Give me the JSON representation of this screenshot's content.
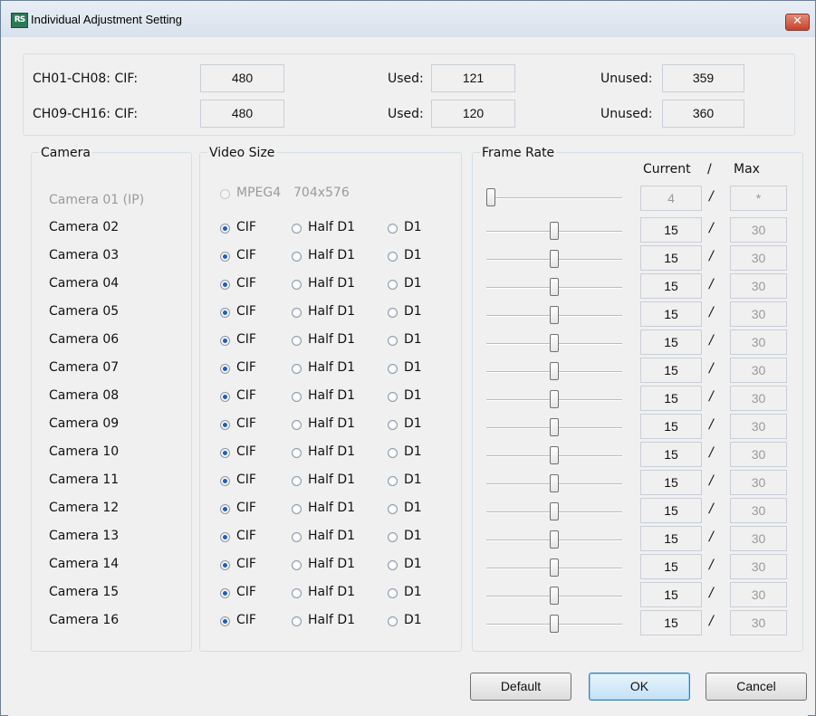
{
  "window": {
    "title": "Individual Adjustment Setting",
    "app_icon_text": "RS",
    "close_glyph": "✕"
  },
  "summary": [
    {
      "label": "CH01-CH08: CIF:",
      "total": "480",
      "used_label": "Used:",
      "used": "121",
      "unused_label": "Unused:",
      "unused": "359"
    },
    {
      "label": "CH09-CH16: CIF:",
      "total": "480",
      "used_label": "Used:",
      "used": "120",
      "unused_label": "Unused:",
      "unused": "360"
    }
  ],
  "groups": {
    "camera": "Camera",
    "video_size": "Video Size",
    "frame_rate": "Frame Rate"
  },
  "frame_rate_headers": {
    "current": "Current",
    "sep": "/",
    "max": "Max"
  },
  "slash": "/",
  "video_options": {
    "cif": "CIF",
    "half_d1": "Half D1",
    "d1": "D1"
  },
  "ip_camera": {
    "name": "Camera 01 (IP)",
    "format": "MPEG4",
    "resolution": "704x576",
    "current": "4",
    "max": "*",
    "slider_value": 4,
    "disabled": true
  },
  "cameras": [
    {
      "name": "Camera 02",
      "selected": "CIF",
      "current": "15",
      "max": "30",
      "slider_value": 15
    },
    {
      "name": "Camera 03",
      "selected": "CIF",
      "current": "15",
      "max": "30",
      "slider_value": 15
    },
    {
      "name": "Camera 04",
      "selected": "CIF",
      "current": "15",
      "max": "30",
      "slider_value": 15
    },
    {
      "name": "Camera 05",
      "selected": "CIF",
      "current": "15",
      "max": "30",
      "slider_value": 15
    },
    {
      "name": "Camera 06",
      "selected": "CIF",
      "current": "15",
      "max": "30",
      "slider_value": 15
    },
    {
      "name": "Camera 07",
      "selected": "CIF",
      "current": "15",
      "max": "30",
      "slider_value": 15
    },
    {
      "name": "Camera 08",
      "selected": "CIF",
      "current": "15",
      "max": "30",
      "slider_value": 15
    },
    {
      "name": "Camera 09",
      "selected": "CIF",
      "current": "15",
      "max": "30",
      "slider_value": 15
    },
    {
      "name": "Camera 10",
      "selected": "CIF",
      "current": "15",
      "max": "30",
      "slider_value": 15
    },
    {
      "name": "Camera 11",
      "selected": "CIF",
      "current": "15",
      "max": "30",
      "slider_value": 15
    },
    {
      "name": "Camera 12",
      "selected": "CIF",
      "current": "15",
      "max": "30",
      "slider_value": 15
    },
    {
      "name": "Camera 13",
      "selected": "CIF",
      "current": "15",
      "max": "30",
      "slider_value": 15
    },
    {
      "name": "Camera 14",
      "selected": "CIF",
      "current": "15",
      "max": "30",
      "slider_value": 15
    },
    {
      "name": "Camera 15",
      "selected": "CIF",
      "current": "15",
      "max": "30",
      "slider_value": 15
    },
    {
      "name": "Camera 16",
      "selected": "CIF",
      "current": "15",
      "max": "30",
      "slider_value": 15
    }
  ],
  "buttons": {
    "default": "Default",
    "ok": "OK",
    "cancel": "Cancel"
  },
  "colors": {
    "title_gradient_top": "#e9eef5",
    "close_red": "#c4432c",
    "radio_selected": "#1e5fb8",
    "focus_button": "#c4e0f6"
  }
}
